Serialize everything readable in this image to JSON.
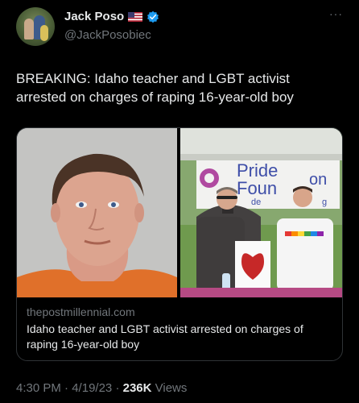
{
  "author": {
    "name": "Jack Poso",
    "handle": "@JackPosobiec",
    "more_label": "···",
    "flag_icon": "us-flag-icon",
    "verified_icon": "verified-badge-icon",
    "verified_color": "#1d9bf0"
  },
  "tweet": {
    "text": "BREAKING: Idaho teacher and LGBT activist arrested on charges of raping 16-year-old boy"
  },
  "card": {
    "domain": "thepostmillennial.com",
    "title": "Idaho teacher and LGBT activist arrested on charges of raping 16-year-old boy",
    "banner_text": "Pride Foun",
    "banner_text_cut": "on",
    "banner_sub": "de",
    "banner_sub_right": "g"
  },
  "meta": {
    "time": "4:30 PM",
    "separator": "·",
    "date": "4/19/23",
    "views_count": "236K",
    "views_label": "Views"
  },
  "colors": {
    "background": "#000000",
    "text_primary": "#e7e9ea",
    "text_secondary": "#71767b",
    "border": "#2f3336"
  }
}
